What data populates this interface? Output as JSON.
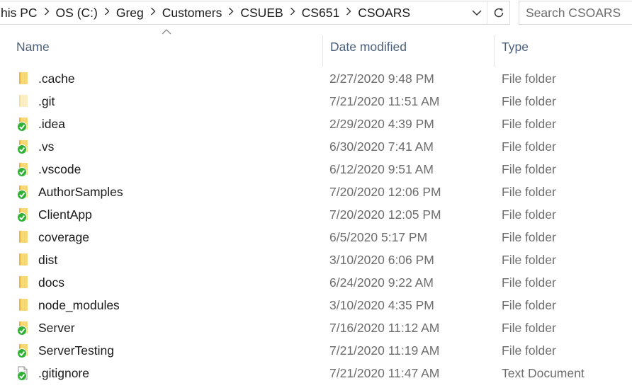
{
  "address_bar": {
    "crumbs": [
      "his PC",
      "OS (C:)",
      "Greg",
      "Customers",
      "CSUEB",
      "CS651",
      "CSOARS"
    ]
  },
  "search": {
    "placeholder": "Search CSOARS"
  },
  "columns": {
    "name": "Name",
    "date": "Date modified",
    "type": "Type"
  },
  "files": [
    {
      "name": ".cache",
      "date": "2/27/2020 9:48 PM",
      "type": "File folder",
      "icon": "folder",
      "synced": false
    },
    {
      "name": ".git",
      "date": "7/21/2020 11:51 AM",
      "type": "File folder",
      "icon": "folder-hidden",
      "synced": false
    },
    {
      "name": ".idea",
      "date": "2/29/2020 4:39 PM",
      "type": "File folder",
      "icon": "folder",
      "synced": true
    },
    {
      "name": ".vs",
      "date": "6/30/2020 7:41 AM",
      "type": "File folder",
      "icon": "folder",
      "synced": true
    },
    {
      "name": ".vscode",
      "date": "6/12/2020 9:51 AM",
      "type": "File folder",
      "icon": "folder",
      "synced": true
    },
    {
      "name": "AuthorSamples",
      "date": "7/20/2020 12:06 PM",
      "type": "File folder",
      "icon": "folder",
      "synced": true
    },
    {
      "name": "ClientApp",
      "date": "7/20/2020 12:05 PM",
      "type": "File folder",
      "icon": "folder",
      "synced": true
    },
    {
      "name": "coverage",
      "date": "6/5/2020 5:17 PM",
      "type": "File folder",
      "icon": "folder",
      "synced": false
    },
    {
      "name": "dist",
      "date": "3/10/2020 6:06 PM",
      "type": "File folder",
      "icon": "folder",
      "synced": false
    },
    {
      "name": "docs",
      "date": "6/24/2020 9:22 AM",
      "type": "File folder",
      "icon": "folder",
      "synced": false
    },
    {
      "name": "node_modules",
      "date": "3/10/2020 4:35 PM",
      "type": "File folder",
      "icon": "folder",
      "synced": false
    },
    {
      "name": "Server",
      "date": "7/16/2020 11:12 AM",
      "type": "File folder",
      "icon": "folder",
      "synced": true
    },
    {
      "name": "ServerTesting",
      "date": "7/21/2020 11:19 AM",
      "type": "File folder",
      "icon": "folder",
      "synced": true
    },
    {
      "name": ".gitignore",
      "date": "7/21/2020 11:47 AM",
      "type": "Text Document",
      "icon": "text-document",
      "synced": true
    }
  ],
  "colors": {
    "folder": "#f8d775",
    "folder_dark": "#e8b73c",
    "folder_hidden": "#fbeec2",
    "sync_green": "#2eb135",
    "header_text": "#4c607a",
    "meta_text": "#6d6d6d"
  }
}
